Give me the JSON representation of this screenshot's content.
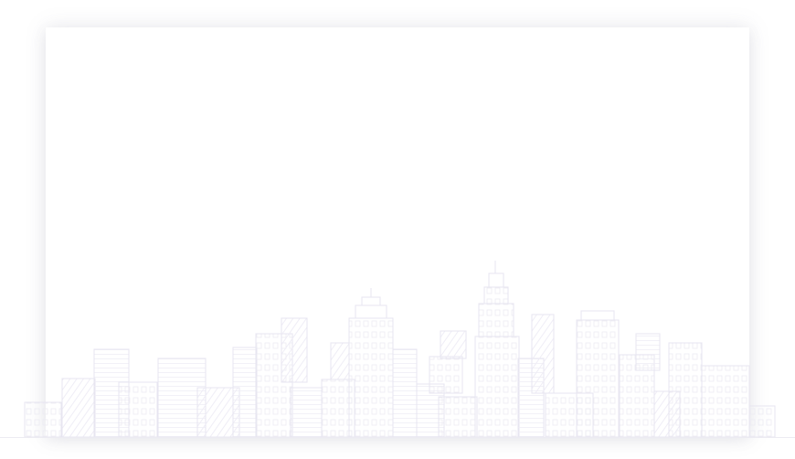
{
  "page": {
    "title": "",
    "background_color": "#ffffff",
    "card_color": "#ffffff"
  },
  "illustration": {
    "icon": "city-skyline-icon",
    "stroke_color": "#e7e5f0",
    "hatch_color": "#efedf6"
  }
}
